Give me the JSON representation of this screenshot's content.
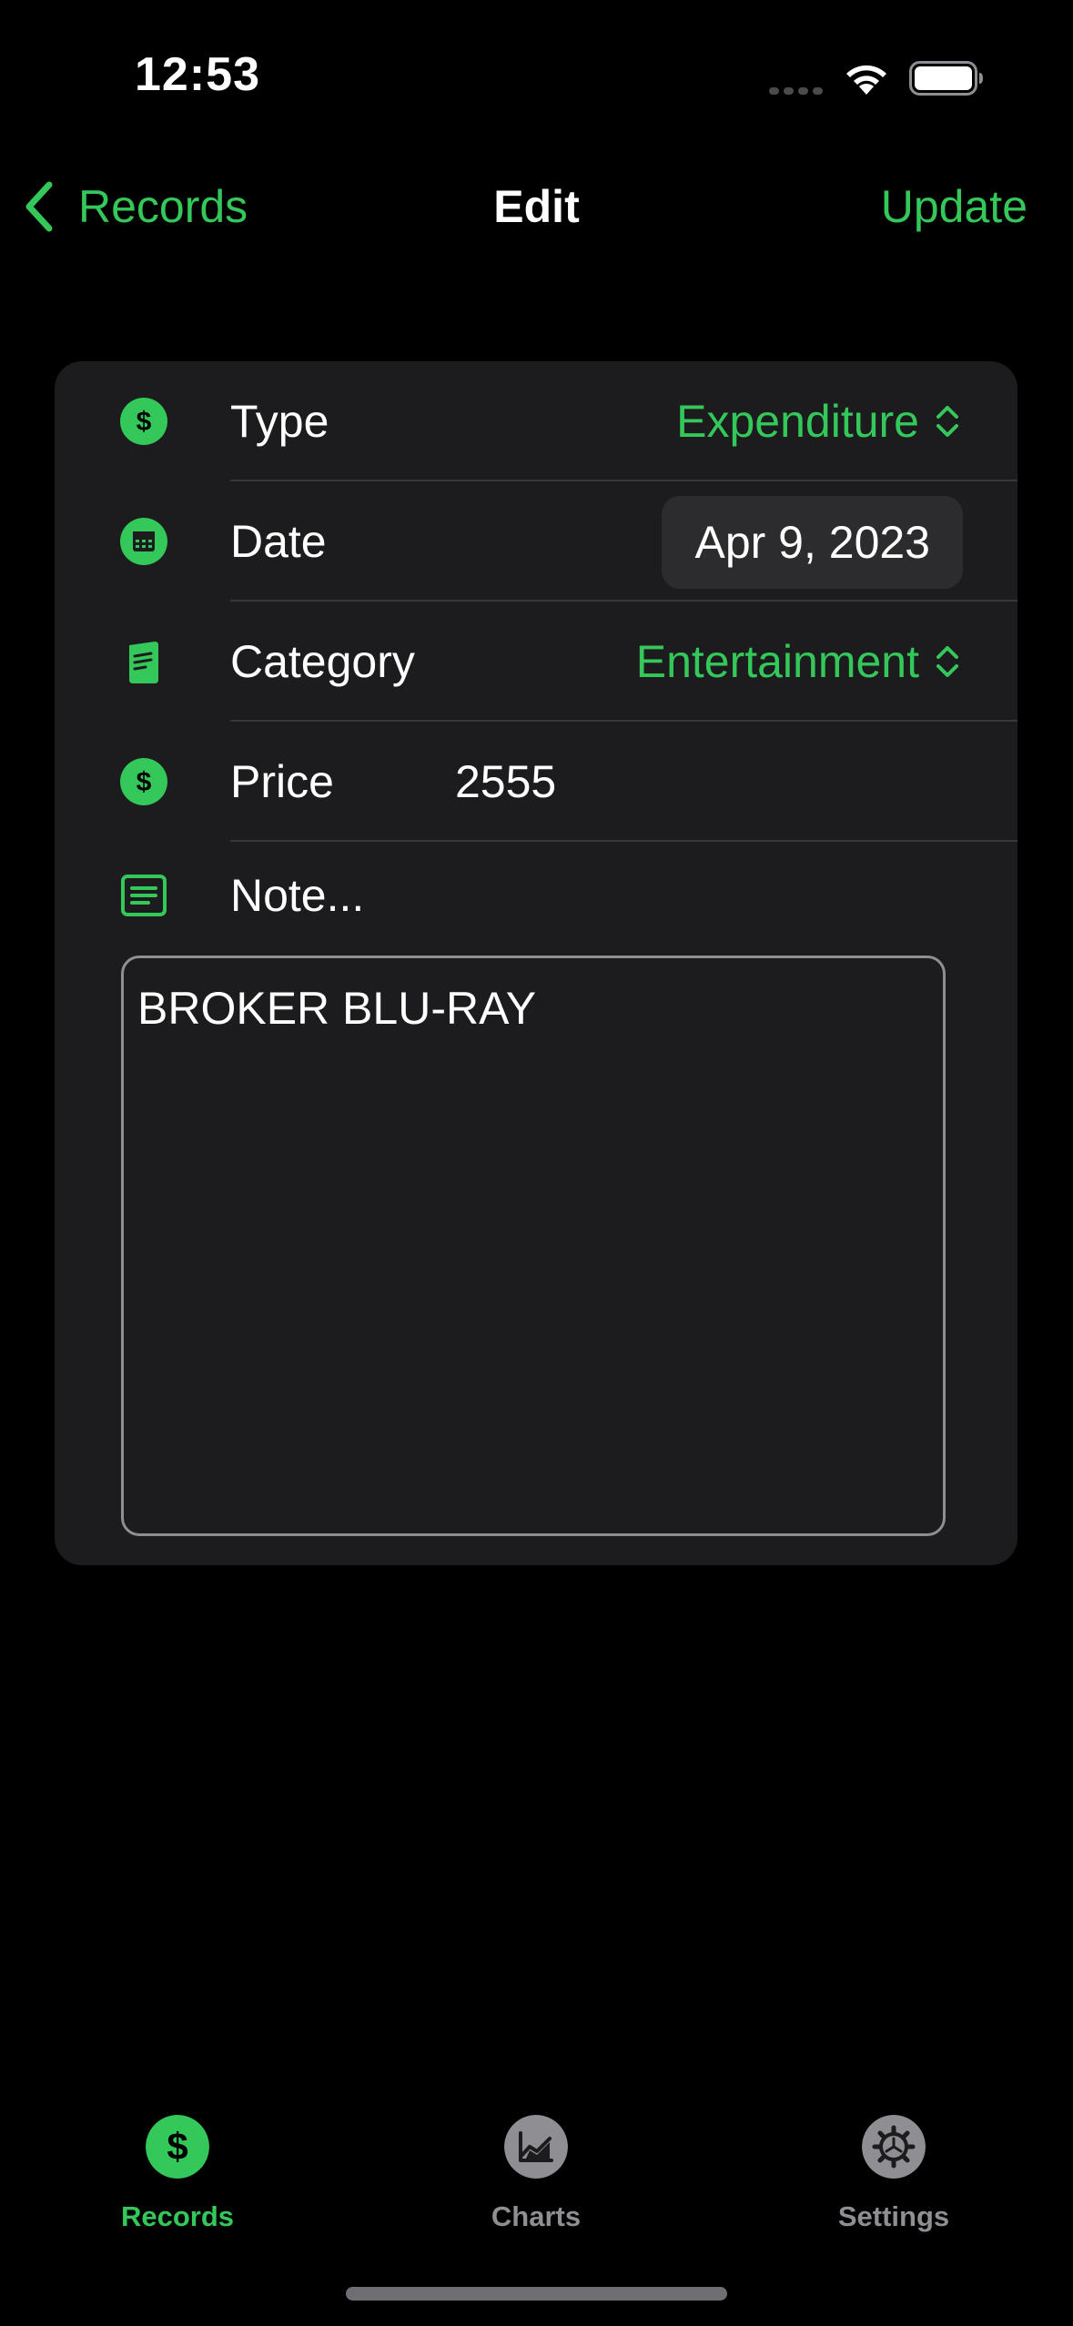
{
  "status_bar": {
    "time": "12:53"
  },
  "nav": {
    "back_label": "Records",
    "title": "Edit",
    "update_label": "Update"
  },
  "form": {
    "type": {
      "label": "Type",
      "value": "Expenditure",
      "icon": "dollar-circle-icon"
    },
    "date": {
      "label": "Date",
      "value": "Apr 9, 2023",
      "icon": "calendar-icon"
    },
    "category": {
      "label": "Category",
      "value": "Entertainment",
      "icon": "receipt-icon"
    },
    "price": {
      "label": "Price",
      "value": "2555",
      "icon": "dollar-circle-icon"
    },
    "note": {
      "label": "Note...",
      "value": "BROKER BLU-RAY",
      "icon": "note-icon"
    }
  },
  "tabs": [
    {
      "label": "Records",
      "icon": "dollar-icon",
      "active": true
    },
    {
      "label": "Charts",
      "icon": "chart-icon",
      "active": false
    },
    {
      "label": "Settings",
      "icon": "gear-icon",
      "active": false
    }
  ],
  "colors": {
    "accent": "#34c759",
    "background": "#000000",
    "card": "#1c1c1e",
    "inactive_tab": "#8e8e93"
  }
}
